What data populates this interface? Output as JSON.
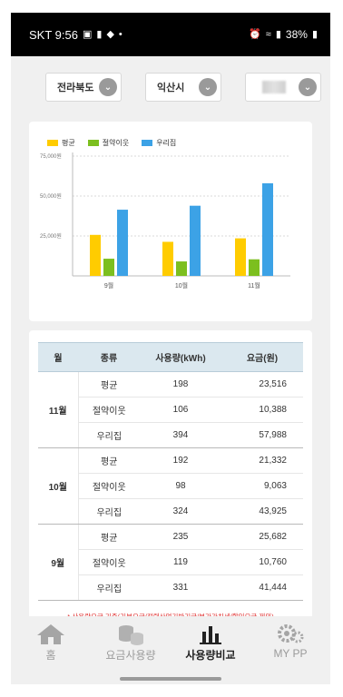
{
  "status_bar": {
    "carrier_time": "SKT 9:56",
    "battery": "38%",
    "icons": [
      "gallery-icon",
      "chat-icon",
      "shield-icon",
      "dot-icon",
      "alarm-icon",
      "wifi-icon",
      "signal-icon",
      "battery-icon"
    ]
  },
  "filters": {
    "province": "전라북도",
    "city": "익산시",
    "district": ""
  },
  "chart_data": {
    "type": "bar",
    "categories": [
      "9월",
      "10월",
      "11월"
    ],
    "series": [
      {
        "name": "평균",
        "values": [
          25682,
          21332,
          23516
        ],
        "color": "#ffcc00"
      },
      {
        "name": "절약이웃",
        "values": [
          10760,
          9063,
          10388
        ],
        "color": "#7cbf1f"
      },
      {
        "name": "우리집",
        "values": [
          41444,
          43925,
          57988
        ],
        "color": "#3ca2e6"
      }
    ],
    "yticks": [
      "25,000원",
      "50,000원",
      "75,000원"
    ],
    "ylim": [
      0,
      75000
    ],
    "grid": true,
    "legend": "top-left"
  },
  "table": {
    "headers": [
      "월",
      "종류",
      "사용량(kWh)",
      "요금(원)"
    ],
    "groups": [
      {
        "month": "11월",
        "rows": [
          {
            "type": "평균",
            "usage": "198",
            "fee": "23,516"
          },
          {
            "type": "절약이웃",
            "usage": "106",
            "fee": "10,388"
          },
          {
            "type": "우리집",
            "usage": "394",
            "fee": "57,988"
          }
        ]
      },
      {
        "month": "10월",
        "rows": [
          {
            "type": "평균",
            "usage": "192",
            "fee": "21,332"
          },
          {
            "type": "절약이웃",
            "usage": "98",
            "fee": "9,063"
          },
          {
            "type": "우리집",
            "usage": "324",
            "fee": "43,925"
          }
        ]
      },
      {
        "month": "9월",
        "rows": [
          {
            "type": "평균",
            "usage": "235",
            "fee": "25,682"
          },
          {
            "type": "절약이웃",
            "usage": "119",
            "fee": "10,760"
          },
          {
            "type": "우리집",
            "usage": "331",
            "fee": "41,444"
          }
        ]
      }
    ],
    "note": "* 사용량요금 기준(기본요금/전력산업기반기금/부가가치세/할인요금 제외)"
  },
  "nav": {
    "items": [
      {
        "label": "홈",
        "icon": "home-icon"
      },
      {
        "label": "요금사용량",
        "icon": "coins-icon"
      },
      {
        "label": "사용량비교",
        "icon": "bar-chart-icon"
      },
      {
        "label": "MY PP",
        "icon": "gears-icon"
      }
    ],
    "active": "사용량비교"
  },
  "colors": {
    "accent_active": "#222222",
    "inactive": "#9a9a9a",
    "note": "#e03030"
  }
}
